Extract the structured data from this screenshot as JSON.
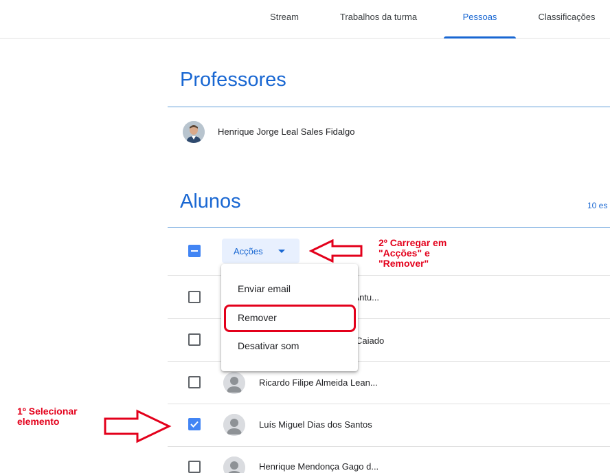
{
  "tabs": [
    {
      "label": "Stream",
      "active": false
    },
    {
      "label": "Trabalhos da turma",
      "active": false
    },
    {
      "label": "Pessoas",
      "active": true
    },
    {
      "label": "Classificações",
      "active": false
    }
  ],
  "teachers": {
    "title": "Professores",
    "items": [
      {
        "name": "Henrique Jorge Leal Sales Fidalgo"
      }
    ]
  },
  "students": {
    "title": "Alunos",
    "count_text": "10 es",
    "actions_label": "Acções",
    "select_all_state": "indeterminate",
    "items": [
      {
        "name": "s Antu...",
        "checked": false
      },
      {
        "name": "Caiado",
        "checked": false
      },
      {
        "name": "Ricardo Filipe Almeida Lean...",
        "checked": false
      },
      {
        "name": "Luís Miguel Dias dos Santos",
        "checked": true
      },
      {
        "name": "Henrique Mendonça Gago d...",
        "checked": false
      }
    ]
  },
  "actions_menu": {
    "items": [
      {
        "label": "Enviar email"
      },
      {
        "label": "Remover"
      },
      {
        "label": "Desativar som"
      }
    ]
  },
  "annotations": {
    "step1": "1º Selecionar\nelemento",
    "step2": "2º Carregar em\n\"Acções\" e\n\"Remover\"",
    "color": "#e3001b"
  },
  "colors": {
    "accent": "#1967d2",
    "checkbox_blue": "#4285f4"
  }
}
